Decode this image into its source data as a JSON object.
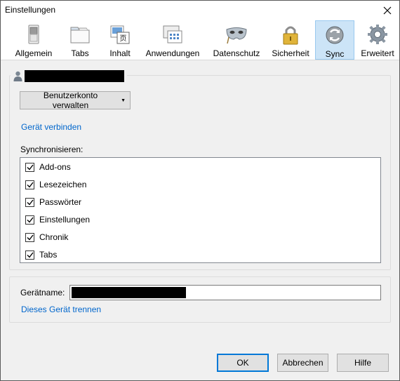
{
  "window": {
    "title": "Einstellungen"
  },
  "tabs": [
    {
      "label": "Allgemein",
      "icon": "switch-icon"
    },
    {
      "label": "Tabs",
      "icon": "tabs-icon"
    },
    {
      "label": "Inhalt",
      "icon": "content-icon"
    },
    {
      "label": "Anwendungen",
      "icon": "applications-icon"
    },
    {
      "label": "Datenschutz",
      "icon": "mask-icon"
    },
    {
      "label": "Sicherheit",
      "icon": "padlock-icon"
    },
    {
      "label": "Sync",
      "icon": "sync-icon",
      "active": true
    },
    {
      "label": "Erweitert",
      "icon": "gear-icon"
    }
  ],
  "account": {
    "manage_button": "Benutzerkonto verwalten",
    "connect_link": "Gerät verbinden"
  },
  "sync": {
    "heading": "Synchronisieren:",
    "items": [
      {
        "label": "Add-ons",
        "checked": true
      },
      {
        "label": "Lesezeichen",
        "checked": true
      },
      {
        "label": "Passwörter",
        "checked": true
      },
      {
        "label": "Einstellungen",
        "checked": true
      },
      {
        "label": "Chronik",
        "checked": true
      },
      {
        "label": "Tabs",
        "checked": true
      }
    ]
  },
  "device": {
    "name_label": "Gerätname:",
    "disconnect_link": "Dieses Gerät trennen"
  },
  "buttons": {
    "ok": "OK",
    "cancel": "Abbrechen",
    "help": "Hilfe"
  },
  "colors": {
    "link": "#0066cc",
    "active_tab": "#cce4f7",
    "default_button_border": "#0078d7"
  }
}
